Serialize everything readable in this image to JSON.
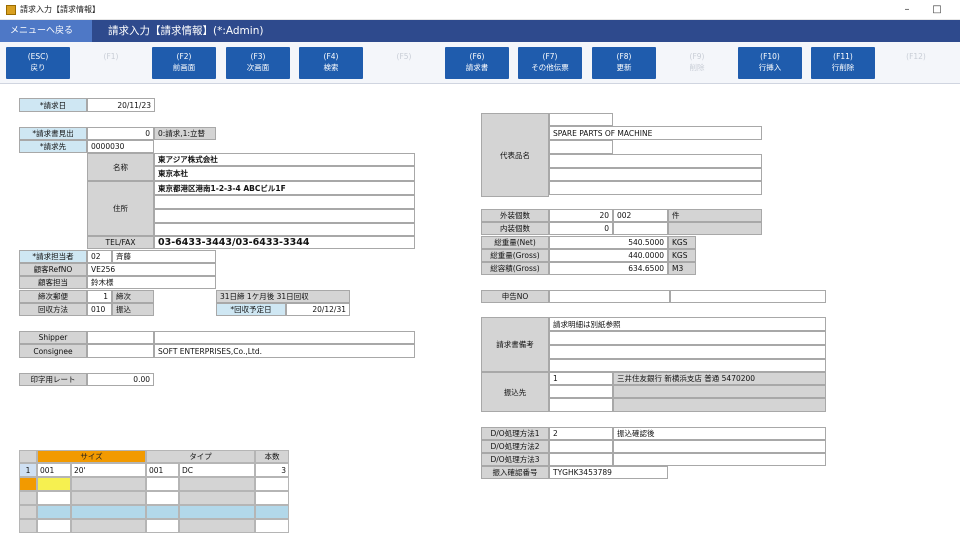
{
  "window": {
    "title": "請求入力【請求情報】",
    "minimize": "–",
    "maximize": "□"
  },
  "header": {
    "menu_back": "メニューへ戻る",
    "screen_title": "請求入力【請求情報】(*:Admin)"
  },
  "fkeys": [
    {
      "key": "(ESC)",
      "label": "戻り",
      "enabled": true
    },
    {
      "key": "(F1)",
      "label": "",
      "enabled": false
    },
    {
      "key": "(F2)",
      "label": "前画面",
      "enabled": true
    },
    {
      "key": "(F3)",
      "label": "次画面",
      "enabled": true
    },
    {
      "key": "(F4)",
      "label": "検索",
      "enabled": true
    },
    {
      "key": "(F5)",
      "label": "",
      "enabled": false
    },
    {
      "key": "(F6)",
      "label": "請求書",
      "enabled": true
    },
    {
      "key": "(F7)",
      "label": "その他伝票",
      "enabled": true
    },
    {
      "key": "(F8)",
      "label": "更新",
      "enabled": true
    },
    {
      "key": "(F9)",
      "label": "削除",
      "enabled": false
    },
    {
      "key": "(F10)",
      "label": "行挿入",
      "enabled": true
    },
    {
      "key": "(F11)",
      "label": "行削除",
      "enabled": true
    },
    {
      "key": "(F12)",
      "label": "",
      "enabled": false
    }
  ],
  "left": {
    "invoice_date_label": "*請求日",
    "invoice_date": "20/11/23",
    "invoice_heading_label": "*請求書見出",
    "invoice_heading_value": "0",
    "invoice_heading_hint": "0:請求,1:立替",
    "bill_to_label": "*請求先",
    "bill_to_code": "0000030",
    "name_label": "名称",
    "name_line1": "東アジア株式会社",
    "name_line2": "東京本社",
    "address_label": "住所",
    "address_line1": "東京都港区港南1-2-3-4  ABCビル1F",
    "telfax_label": "TEL/FAX",
    "telfax_value": "03-6433-3443/03-6433-3344",
    "person_label": "*請求担当者",
    "person_code": "02",
    "person_name": "斉藤",
    "customer_ref_label": "顧客RefNO",
    "customer_ref_value": "VE256",
    "customer_contact_label": "顧客担当",
    "customer_contact_value": "鈴木様",
    "closing_label": "締次郵便",
    "closing_value": "1",
    "closing_unit": "締次",
    "terms_text": "31日締  1ケ月後  31日回収",
    "collection_label": "回収方法",
    "collection_code": "010",
    "collection_name": "振込",
    "collection_due_label": "*回収予定日",
    "collection_due_value": "20/12/31",
    "shipper_label": "Shipper",
    "shipper_value": "",
    "consignee_label": "Consignee",
    "consignee_value": "SOFT ENTERPRISES,Co.,Ltd.",
    "print_rate_label": "印字用レート",
    "print_rate_value": "0.00"
  },
  "grid": {
    "headers": [
      "サイズ",
      "タイプ",
      "本数"
    ],
    "row1": {
      "no": "1",
      "size_code": "001",
      "size_name": "20'",
      "type_code": "001",
      "type_name": "DC",
      "qty": "3"
    }
  },
  "right": {
    "product_label": "代表品名",
    "product_line1": "SPARE PARTS OF MACHINE",
    "outer_count_label": "外装個数",
    "outer_count_value": "20",
    "outer_count_code": "002",
    "outer_count_unit": "件",
    "inner_count_label": "内装個数",
    "inner_count_value": "0",
    "net_weight_label": "総重量(Net)",
    "net_weight_value": "540.5000",
    "net_weight_unit": "KGS",
    "gross_weight_label": "総重量(Gross)",
    "gross_weight_value": "440.0000",
    "gross_weight_unit": "KGS",
    "gross_volume_label": "総容積(Gross)",
    "gross_volume_value": "634.6500",
    "gross_volume_unit": "M3",
    "declare_label": "申告NO",
    "remarks_label": "請求書備考",
    "remarks_line1": "請求明細は別紙参照",
    "payee_label": "振込先",
    "payee_code": "1",
    "payee_bank": "三井住友銀行  新横浜支店  普通 5470200",
    "do1_label": "D/O処理方法1",
    "do1_code": "2",
    "do1_text": "振込確認後",
    "do2_label": "D/O処理方法2",
    "do3_label": "D/O処理方法3",
    "deposit_label": "振入確認番号",
    "deposit_value": "TYGHK3453789"
  },
  "colors": {
    "header": "#2e4a8d",
    "fkey": "#1f5cad",
    "grid_header": "#f29a00",
    "highlight_yellow": "#f6f050",
    "highlight_blue": "#b2d8ea"
  }
}
